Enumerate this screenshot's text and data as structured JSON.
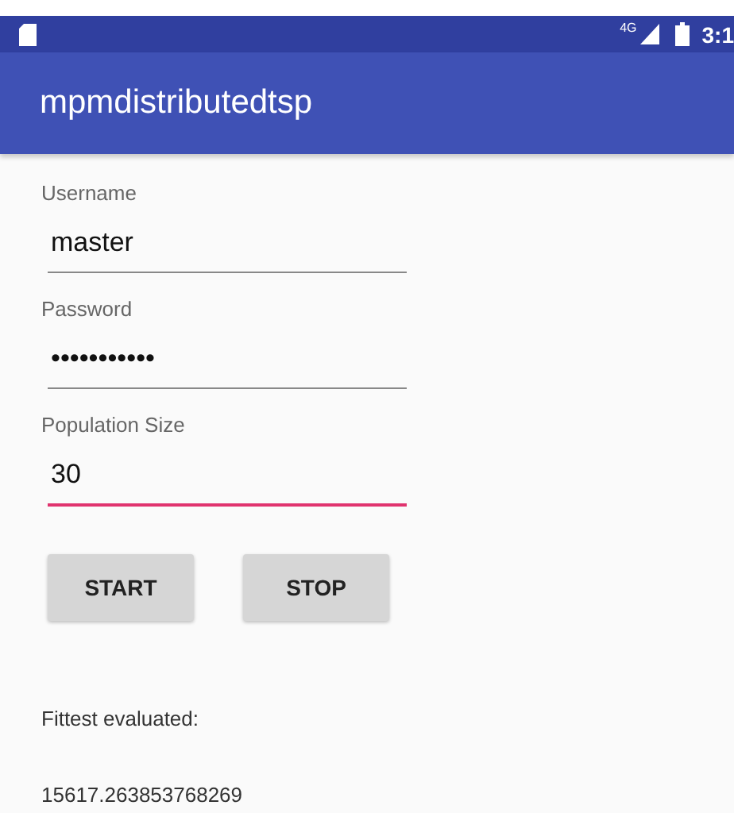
{
  "status_bar": {
    "network": "4G",
    "time": "3:1"
  },
  "app_bar": {
    "title": "mpmdistributedtsp"
  },
  "fields": [
    {
      "label": "Username",
      "value": "master",
      "focused": false
    },
    {
      "label": "Password",
      "value": "•••••••••••",
      "focused": false
    },
    {
      "label": "Population Size",
      "value": "30",
      "focused": true
    }
  ],
  "buttons": [
    "START",
    "STOP"
  ],
  "result": {
    "label": "Fittest evaluated:",
    "value": "15617.263853768269"
  }
}
